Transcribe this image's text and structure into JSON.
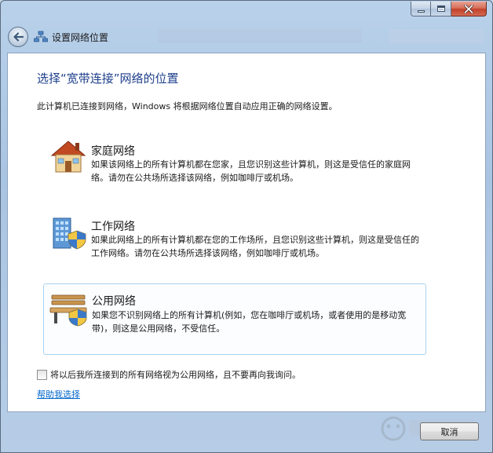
{
  "window": {
    "title": "设置网络位置"
  },
  "heading": "选择“宽带连接”网络的位置",
  "intro": "此计算机已连接到网络，Windows 将根据网络位置自动应用正确的网络设置。",
  "options": [
    {
      "title": "家庭网络",
      "description": "如果该网络上的所有计算机都在您家，且您识别这些计算机，则这是受信任的家庭网络。请勿在公共场所选择该网络，例如咖啡厅或机场。",
      "icon": "house-icon"
    },
    {
      "title": "工作网络",
      "description": "如果此网络上的所有计算机都在您的工作场所，且您识别这些计算机，则这是受信任的工作网络。请勿在公共场所选择该网络，例如咖啡厅或机场。",
      "icon": "office-building-icon"
    },
    {
      "title": "公用网络",
      "description": "如果您不识别网络上的所有计算机(例如，您在咖啡厅或机场，或者使用的是移动宽带)，则这是公用网络，不受信任。",
      "icon": "park-bench-icon",
      "selected": true
    }
  ],
  "checkbox": {
    "label": "将以后我所连接到的所有网络视为公用网络，且不要再向我询问。",
    "checked": false
  },
  "help_link": "帮助我选择",
  "cancel_label": "取消",
  "colors": {
    "heading": "#1e3f8c",
    "link": "#0066cc",
    "selected_border": "#a9d2f0"
  }
}
